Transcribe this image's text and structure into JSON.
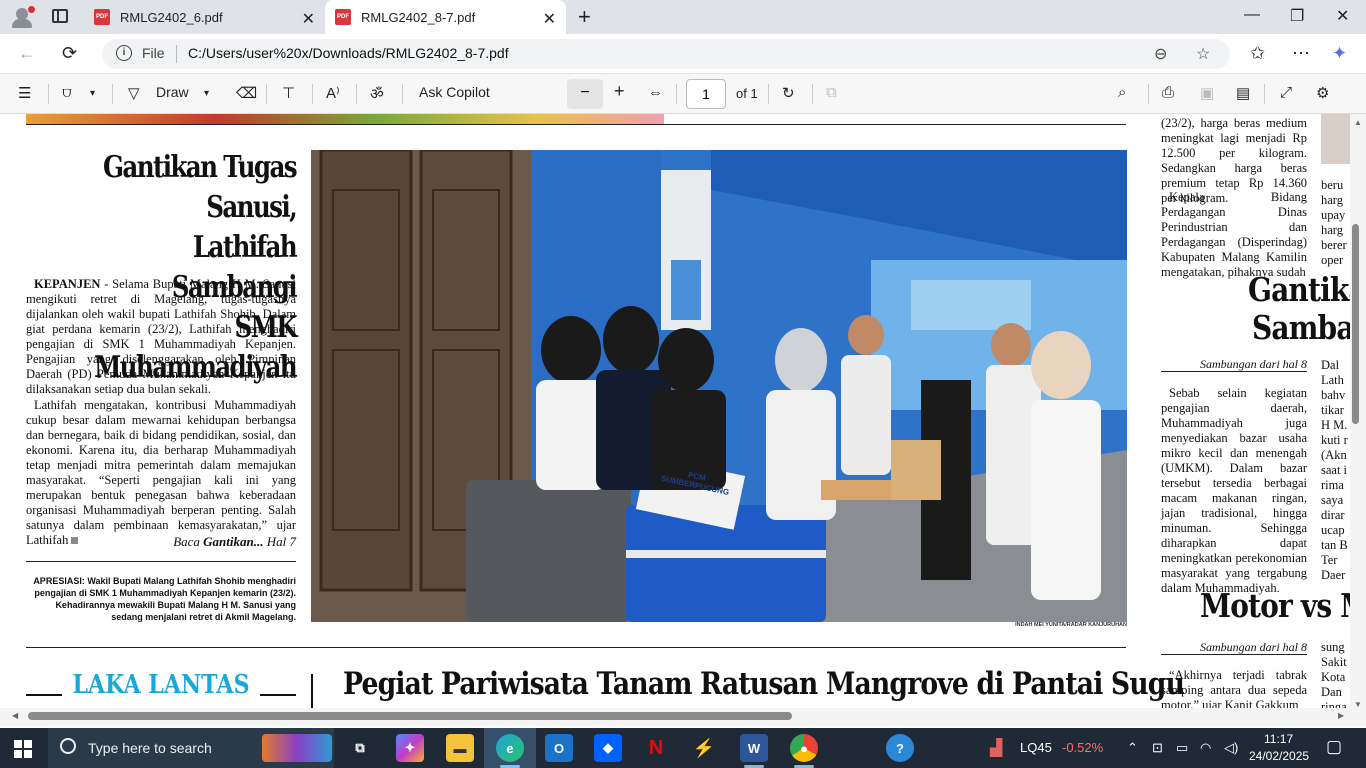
{
  "browser": {
    "tabs": [
      {
        "title": "RMLG2402_6.pdf",
        "active": false
      },
      {
        "title": "RMLG2402_8-7.pdf",
        "active": true
      }
    ],
    "address": {
      "scheme_label": "File",
      "url": "C:/Users/user%20x/Downloads/RMLG2402_8-7.pdf"
    }
  },
  "pdf_toolbar": {
    "draw_label": "Draw",
    "copilot_label": "Ask Copilot",
    "page_current": "1",
    "page_total": "of 1"
  },
  "article": {
    "headline_lines": [
      "Gantikan Tugas Sanusi,",
      "Lathifah Sambangi",
      "SMK Muhammadiyah"
    ],
    "dateline": "KEPANJEN",
    "para1": " - Selama Bupati Malang H M. Sanusi mengikuti retret di Magelang, tugas-tugasnya dijalankan oleh wakil bupati Lathifah Shohib. Dalam giat perdana kemarin (23/2), Lathifah menghadiri pengajian di SMK 1 Muhammadiyah Kepanjen. Pengajian yang diselenggarakan oleh Pimpinan Daerah (PD) Pemuda Muhammadiyah Kepanjen itu dilaksanakan setiap dua bulan sekali.",
    "para2": "Lathifah mengatakan, kontribusi Muhammadiyah cukup besar dalam mewarnai kehidupan berbangsa dan bernegara, baik di bidang pendidikan, sosial, dan ekonomi. Karena itu, dia berharap Muhammadiyah tetap menjadi mitra pemerintah dalam memajukan masyarakat. “Seperti pengajian kali ini yang merupakan bentuk penegasan bahwa keberadaan organisasi Muhammadiyah berperan penting. Salah satunya dalam pembinaan kemasyarakatan,” ujar Lathifah",
    "byline_prefix": "Baca ",
    "byline_bold": "Gantikan...",
    "byline_suffix": " Hal 7",
    "caption": "APRESIASI: Wakil Bupati Malang Lathifah Shohib menghadiri pengajian di SMK 1 Muhammadiyah Kepanjen kemarin (23/2). Kehadirannya mewakili Bupati Malang H M. Sanusi yang sedang menjalani retret di Akmil Magelang.",
    "photo_credit": "INDAH MEI YUNITA/RADAR KANJURUHAN",
    "photo_sign": "PCM SUMBERPUCUNG"
  },
  "bottom": {
    "section_label": "LAKA LANTAS",
    "headline": "Pegiat Pariwisata Tanam Ratusan Mangrove di Pantai Sugu"
  },
  "right_column": {
    "text1": "(23/2), harga beras medium meningkat lagi menjadi Rp 12.500 per kilogram. Sedangkan harga beras premium tetap Rp 14.360 per kilogram.",
    "text2": "Kepala Bidang Perdagangan Dinas Perindustrian dan Perdagangan (Disperindag) Kabupaten Malang Kamilin mengatakan, pihaknya sudah",
    "head1_line1": "Gantika",
    "head1_line2": "Samba",
    "samb1": "Sambungan dari hal 8",
    "text3": "Sebab selain kegiatan pengajian daerah, Muhammadiyah juga menyediakan bazar usaha mikro kecil dan menengah (UMKM). Dalam bazar tersebut tersedia berbagai macam makanan ringan, jajan tradisional, hingga minuman. Sehingga diharapkan dapat meningkatkan perekonomian masyarakat yang tergabung dalam Muhammadiyah.",
    "head2": "Motor vs M",
    "samb2": "Sambungan dari hal 8",
    "text4": "“Akhirnya terjadi tabrak samping antara dua sepeda motor,” ujar Kanit Gakkum",
    "frag_col_a": [
      "beru",
      "harg",
      "upay",
      "harg",
      "berer",
      "oper"
    ],
    "frag_col_b": [
      "Dal",
      "Lath",
      "bahv",
      "tikar",
      "H M.",
      "kuti r",
      "(Akn",
      "saat i",
      "rima",
      "saya",
      "dirar",
      "ucap",
      "tan B",
      "Ter",
      "Daer"
    ],
    "frag_col_c": [
      "sung",
      "Sakit",
      "Kota",
      "Dan",
      "ringa"
    ]
  },
  "taskbar": {
    "search_placeholder": "Type here to search",
    "ticker_name": "LQ45",
    "ticker_change": "-0.52%",
    "time": "11:17",
    "date": "24/02/2025"
  },
  "colors": {
    "accent_laka": "#1aa7d9",
    "ticker_down": "#ff6b6b"
  }
}
